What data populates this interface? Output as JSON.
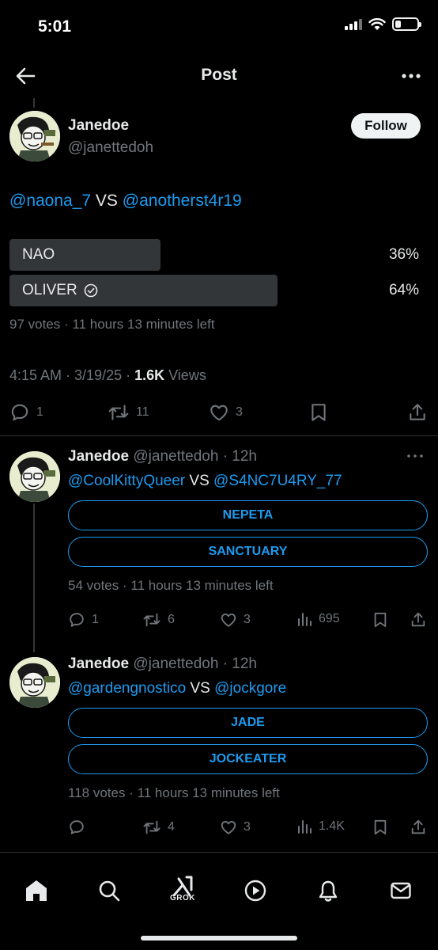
{
  "status_bar": {
    "time": "5:01"
  },
  "topbar": {
    "title": "Post"
  },
  "main_post": {
    "author_name": "Janedoe",
    "author_handle": "@janettedoh",
    "follow_label": "Follow",
    "text": {
      "mention_a": "@naona_7",
      "vs": "VS",
      "mention_b": "@anotherst4r19"
    },
    "poll": {
      "options": [
        {
          "label": "NAO",
          "percent": "36%",
          "fraction": 0.36,
          "winner": false
        },
        {
          "label": "OLIVER",
          "percent": "64%",
          "fraction": 0.64,
          "winner": true
        }
      ],
      "meta": "97 votes · 11 hours 13 minutes left"
    },
    "timestamp": {
      "time": "4:15 AM · 3/19/25 · ",
      "views_count": "1.6K",
      "views_label": " Views"
    },
    "actions": {
      "replies": "1",
      "reposts": "11",
      "likes": "3"
    }
  },
  "replies": [
    {
      "author_name": "Janedoe",
      "author_handle": "@janettedoh · 12h",
      "text": {
        "mention_a": "@CoolKittyQueer",
        "vs": "VS",
        "mention_b": "@S4NC7U4RY_77"
      },
      "poll_options": [
        "NEPETA",
        "SANCTUARY"
      ],
      "meta": "54 votes · 11 hours 13 minutes left",
      "actions": {
        "replies": "1",
        "reposts": "6",
        "likes": "3",
        "views": "695"
      }
    },
    {
      "author_name": "Janedoe",
      "author_handle": "@janettedoh · 12h",
      "text": {
        "mention_a": "@gardengnostico",
        "vs": "VS",
        "mention_b": "@jockgore"
      },
      "poll_options": [
        "JADE",
        "JOCKEATER"
      ],
      "meta": "118 votes · 11 hours 13 minutes left",
      "actions": {
        "replies": "",
        "reposts": "4",
        "likes": "3",
        "views": "1.4K"
      }
    }
  ],
  "bottom_nav": {
    "grok_label": "GROK"
  },
  "colors": {
    "accent": "#1d9bf0",
    "muted": "#71767b",
    "text": "#e7e9ea",
    "bar": "#333639"
  }
}
